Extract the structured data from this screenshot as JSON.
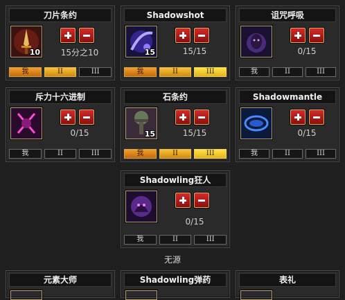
{
  "cards": [
    {
      "title": "刀片条约",
      "rank": "10",
      "count": "15分之10",
      "tiers": [
        "我",
        "II",
        "III"
      ],
      "filled": [
        1,
        1,
        0
      ],
      "icon": "dagger-icon"
    },
    {
      "title": "Shadowshot",
      "rank": "15",
      "count": "15/15",
      "tiers": [
        "我",
        "II",
        "III"
      ],
      "filled": [
        1,
        1,
        1
      ],
      "icon": "shadowshot-icon"
    },
    {
      "title": "诅咒呼吸",
      "rank": "",
      "count": "0/15",
      "tiers": [
        "我",
        "II",
        "III"
      ],
      "filled": [
        0,
        0,
        0
      ],
      "icon": "cursed-breath-icon"
    },
    {
      "title": "斥力十六进制",
      "rank": "",
      "count": "0/15",
      "tiers": [
        "我",
        "II",
        "III"
      ],
      "filled": [
        0,
        0,
        0
      ],
      "icon": "repulsion-hex-icon"
    },
    {
      "title": "石条约",
      "rank": "15",
      "count": "15/15",
      "tiers": [
        "我",
        "II",
        "III"
      ],
      "filled": [
        1,
        1,
        1
      ],
      "icon": "stone-pact-icon"
    },
    {
      "title": "Shadowmantle",
      "rank": "",
      "count": "0/15",
      "tiers": [
        "我",
        "II",
        "III"
      ],
      "filled": [
        0,
        0,
        0
      ],
      "icon": "shadowmantle-icon"
    },
    {
      "title": "Shadowling狂人",
      "rank": "",
      "count": "0/15",
      "tiers": [
        "我",
        "II",
        "III"
      ],
      "filled": [
        0,
        0,
        0
      ],
      "icon": "shadowling-frenzy-icon"
    },
    {
      "title": "元素大师",
      "rank": "",
      "count": "",
      "tiers": [],
      "filled": [],
      "icon": "element-master-icon"
    },
    {
      "title": "Shadowling弹药",
      "rank": "",
      "count": "",
      "tiers": [],
      "filled": [],
      "icon": "shadowling-ammo-icon"
    },
    {
      "title": "表礼",
      "rank": "",
      "count": "",
      "tiers": [],
      "filled": [],
      "icon": "gift-icon"
    }
  ],
  "no_passive_label": "无源",
  "colors": {
    "accent_red": "#c81e1e",
    "tier_orange": "#f0a02a",
    "tier_gold": "#fce24a",
    "frame": "#b9a36a"
  }
}
